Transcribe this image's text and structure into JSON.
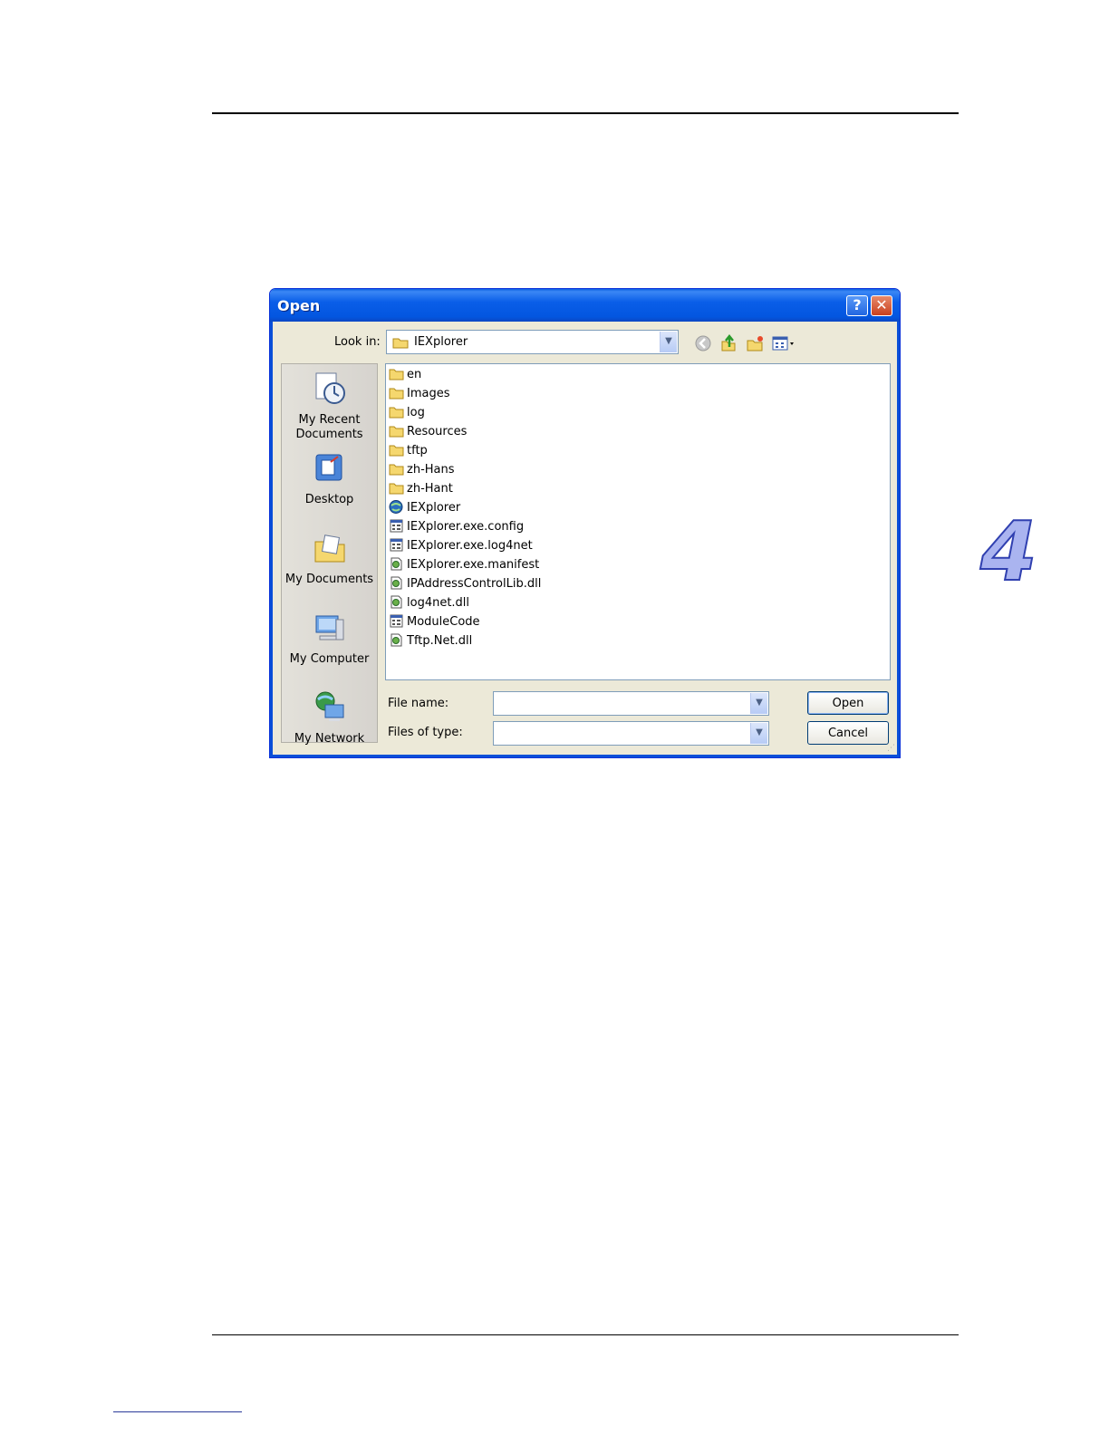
{
  "dialog": {
    "title": "Open",
    "help_glyph": "?",
    "close_glyph": "✕",
    "look_in_label": "Look in:",
    "look_in_value": "IEXplorer",
    "places": [
      "My Recent Documents",
      "Desktop",
      "My Documents",
      "My Computer",
      "My Network"
    ],
    "files": [
      {
        "name": "en",
        "icon": "folder-icon"
      },
      {
        "name": "Images",
        "icon": "folder-icon"
      },
      {
        "name": "log",
        "icon": "folder-icon"
      },
      {
        "name": "Resources",
        "icon": "folder-icon"
      },
      {
        "name": "tftp",
        "icon": "folder-icon"
      },
      {
        "name": "zh-Hans",
        "icon": "folder-icon"
      },
      {
        "name": "zh-Hant",
        "icon": "folder-icon"
      },
      {
        "name": "IEXplorer",
        "icon": "app-icon"
      },
      {
        "name": "IEXplorer.exe.config",
        "icon": "config-file-icon"
      },
      {
        "name": "IEXplorer.exe.log4net",
        "icon": "config-file-icon"
      },
      {
        "name": "IEXplorer.exe.manifest",
        "icon": "dll-file-icon"
      },
      {
        "name": "IPAddressControlLib.dll",
        "icon": "dll-file-icon"
      },
      {
        "name": "log4net.dll",
        "icon": "dll-file-icon"
      },
      {
        "name": "ModuleCode",
        "icon": "config-file-icon"
      },
      {
        "name": "Tftp.Net.dll",
        "icon": "dll-file-icon"
      }
    ],
    "file_name_label": "File name:",
    "file_name_value": "",
    "files_of_type_label": "Files of type:",
    "files_of_type_value": "",
    "open_label": "Open",
    "cancel_label": "Cancel"
  },
  "page": {
    "chapter_number": "4"
  }
}
